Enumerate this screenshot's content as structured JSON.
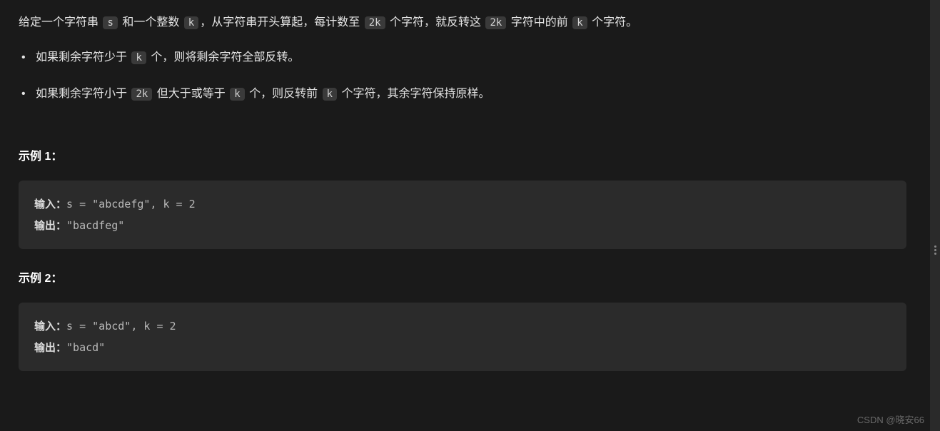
{
  "description": {
    "prefix1": "给定一个字符串 ",
    "code1": "s",
    "mid1": " 和一个整数 ",
    "code2": "k",
    "mid2": "，从字符串开头算起，每计数至 ",
    "code3": "2k",
    "mid3": " 个字符，就反转这 ",
    "code4": "2k",
    "mid4": " 字符中的前 ",
    "code5": "k",
    "suffix": " 个字符。"
  },
  "bullets": [
    {
      "prefix": "如果剩余字符少于 ",
      "code1": "k",
      "suffix": " 个，则将剩余字符全部反转。"
    },
    {
      "prefix": "如果剩余字符小于 ",
      "code1": "2k",
      "mid1": " 但大于或等于 ",
      "code2": "k",
      "mid2": " 个，则反转前 ",
      "code3": "k",
      "suffix": " 个字符，其余字符保持原样。"
    }
  ],
  "examples": [
    {
      "header": "示例 1：",
      "input_label": "输入：",
      "input_value": "s = \"abcdefg\", k = 2",
      "output_label": "输出：",
      "output_value": "\"bacdfeg\""
    },
    {
      "header": "示例 2：",
      "input_label": "输入：",
      "input_value": "s = \"abcd\", k = 2",
      "output_label": "输出：",
      "output_value": "\"bacd\""
    }
  ],
  "watermark": "CSDN @晓安66"
}
